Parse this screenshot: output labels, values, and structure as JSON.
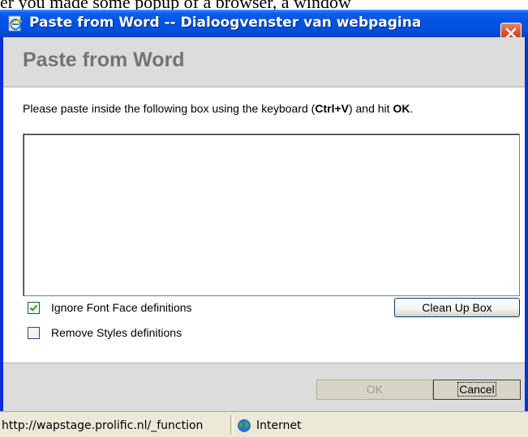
{
  "background_text": "er you made some popup of a browser, a window",
  "window": {
    "title": "Paste from Word -- Dialoogvenster van webpagina",
    "icon": "ie-document-icon",
    "close_icon": "close-icon"
  },
  "dialog": {
    "title": "Paste from Word",
    "instruction_prefix": "Please paste inside the following box using the keyboard (",
    "shortcut": "Ctrl+V",
    "instruction_middle": ") and hit ",
    "ok_word": "OK",
    "instruction_suffix": ".",
    "paste_box_value": "",
    "options": {
      "ignore_font_face": {
        "label": "Ignore Font Face definitions",
        "checked": true
      },
      "remove_styles": {
        "label": "Remove Styles definitions",
        "checked": false
      }
    },
    "cleanup_label": "Clean Up Box",
    "ok_label": "OK",
    "cancel_label": "Cancel"
  },
  "statusbar": {
    "url": "http://wapstage.prolific.nl/_function",
    "zone": "Internet",
    "zone_icon": "globe-icon"
  },
  "colors": {
    "titlebar": "#0054e3",
    "face": "#ece9d8",
    "header": "#dcdcdc",
    "close": "#d9542b"
  }
}
